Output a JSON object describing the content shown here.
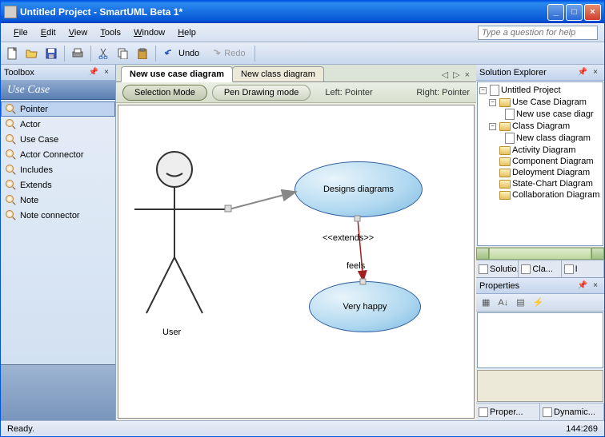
{
  "window": {
    "title": "Untitled Project - SmartUML Beta 1*"
  },
  "menu": {
    "file": "File",
    "edit": "Edit",
    "view": "View",
    "tools": "Tools",
    "window": "Window",
    "help": "Help",
    "helpbox": "Type a question for help"
  },
  "toolbar": {
    "undo": "Undo",
    "redo": "Redo"
  },
  "toolbox": {
    "title": "Toolbox",
    "category": "Use Case",
    "items": [
      "Pointer",
      "Actor",
      "Use Case",
      "Actor Connector",
      "Includes",
      "Extends",
      "Note",
      "Note connector"
    ]
  },
  "tabs": {
    "t1": "New use case diagram",
    "t2": "New class diagram"
  },
  "modes": {
    "selection": "Selection Mode",
    "pen": "Pen Drawing mode",
    "left": "Left: Pointer",
    "right": "Right: Pointer"
  },
  "diagram": {
    "actor": "User",
    "uc1": "Designs diagrams",
    "uc2": "Very happy",
    "rel1": "<<extends>>",
    "rel2": "feels"
  },
  "explorer": {
    "title": "Solution Explorer",
    "root": "Untitled Project",
    "n1": "Use Case Diagram",
    "n1a": "New use case diagr",
    "n2": "Class Diagram",
    "n2a": "New class diagram",
    "n3": "Activity Diagram",
    "n4": "Component Diagram",
    "n5": "Deloyment Diagram",
    "n6": "State-Chart Diagram",
    "n7": "Collaboration Diagram",
    "tab1": "Solutio...",
    "tab2": "Cla...",
    "tab3": "I"
  },
  "properties": {
    "title": "Properties",
    "tab1": "Proper...",
    "tab2": "Dynamic..."
  },
  "status": {
    "ready": "Ready.",
    "coords": "144:269"
  }
}
